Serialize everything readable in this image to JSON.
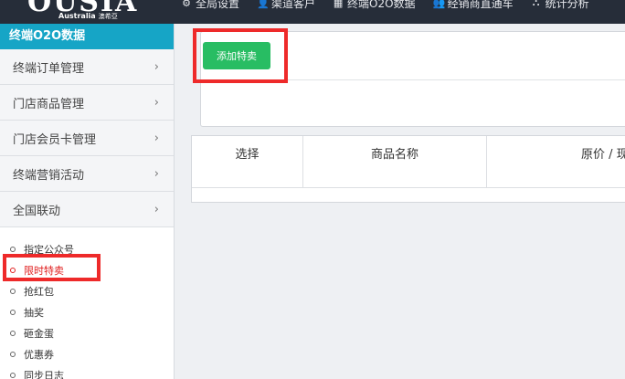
{
  "header": {
    "logo": {
      "main": "OUSIA",
      "sub_en": "Australia",
      "sub_cn": "澳希亞"
    },
    "nav": [
      {
        "icon": "gear-icon",
        "glyph": "⚙",
        "label": "全局设置"
      },
      {
        "icon": "user-icon",
        "glyph": "👤",
        "label": "渠道客户"
      },
      {
        "icon": "grid-icon",
        "glyph": "▦",
        "label": "终端O2O数据"
      },
      {
        "icon": "users-icon",
        "glyph": "👥",
        "label": "经销商直通车"
      },
      {
        "icon": "sitemap-icon",
        "glyph": "⛬",
        "label": "统计分析"
      }
    ]
  },
  "sidebar": {
    "title": "终端O2O数据",
    "menu": [
      {
        "label": "终端订单管理",
        "chevron": "›"
      },
      {
        "label": "门店商品管理",
        "chevron": "›"
      },
      {
        "label": "门店会员卡管理",
        "chevron": "›"
      },
      {
        "label": "终端营销活动",
        "chevron": "›"
      },
      {
        "label": "全国联动",
        "chevron": "›"
      }
    ],
    "submenu": [
      {
        "label": "指定公众号"
      },
      {
        "label": "限时特卖",
        "active": true
      },
      {
        "label": "抢红包"
      },
      {
        "label": "抽奖"
      },
      {
        "label": "砸金蛋"
      },
      {
        "label": "优惠券"
      },
      {
        "label": "同步日志"
      }
    ]
  },
  "main": {
    "add_button": "添加特卖",
    "table_headers": [
      "选择",
      "商品名称",
      "原价 / 现价"
    ]
  },
  "colors": {
    "topbar": "#262d39",
    "sidebar_title": "#16a5c6",
    "add_button": "#28bd63",
    "highlight": "#ee2a2a",
    "active_text": "#e02020"
  }
}
